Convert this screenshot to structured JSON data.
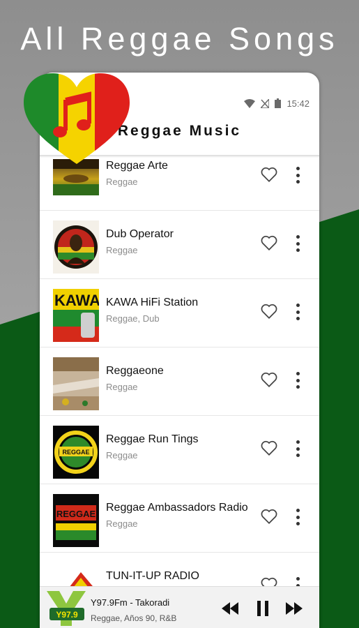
{
  "promo": {
    "title": "All Reggae Songs"
  },
  "statusbar": {
    "time": "15:42"
  },
  "appbar": {
    "title": "Reggae Music"
  },
  "stations": [
    {
      "name": "Reggae Arte",
      "genre": "Reggae",
      "thumb": "reggae-arte"
    },
    {
      "name": "Dub Operator",
      "genre": "Reggae",
      "thumb": "dub-operator"
    },
    {
      "name": "KAWA HiFi Station",
      "genre": "Reggae, Dub",
      "thumb": "kawa",
      "thumb_text": "KAWA"
    },
    {
      "name": "Reggaeone",
      "genre": "Reggae",
      "thumb": "reggaeone"
    },
    {
      "name": "Reggae Run Tings",
      "genre": "Reggae",
      "thumb": "run-tings",
      "thumb_text": "REGGAE"
    },
    {
      "name": "Reggae Ambassadors Radio",
      "genre": "Reggae",
      "thumb": "ambassadors",
      "thumb_text": "REGGAE"
    },
    {
      "name": "TUN-IT-UP RADIO",
      "genre": "",
      "thumb": "tun-it-up"
    }
  ],
  "player": {
    "station": "Y97.9Fm - Takoradi",
    "genre": "Reggae, Años 90, R&B",
    "logo_text": "Y97.9",
    "controls": {
      "previous": "previous-icon",
      "pause": "pause-icon",
      "next": "next-icon"
    }
  },
  "colors": {
    "green": "#0b5a16",
    "yellow": "#f5d300",
    "red": "#e0201b"
  }
}
